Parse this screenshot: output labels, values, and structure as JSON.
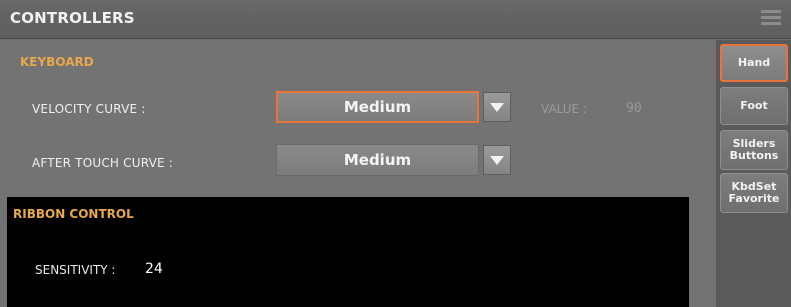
{
  "header": {
    "title": "CONTROLLERS",
    "menu_icon": "hamburger-menu-icon"
  },
  "keyboard": {
    "section_title": "KEYBOARD",
    "velocity_curve": {
      "label": "VELOCITY CURVE :",
      "value": "Medium",
      "value_label": "VALUE :",
      "value_number": "90"
    },
    "after_touch_curve": {
      "label": "AFTER TOUCH CURVE :",
      "value": "Medium"
    }
  },
  "ribbon": {
    "section_title": "RIBBON CONTROL",
    "sensitivity_label": "SENSITIVITY :",
    "sensitivity_value": "24"
  },
  "tabs": [
    {
      "line1": "Hand",
      "line2": ""
    },
    {
      "line1": "Foot",
      "line2": ""
    },
    {
      "line1": "Sliders",
      "line2": "Buttons"
    },
    {
      "line1": "KbdSet",
      "line2": "Favorite"
    }
  ],
  "colors": {
    "accent": "#e8743c",
    "section_title": "#e8a94a"
  }
}
